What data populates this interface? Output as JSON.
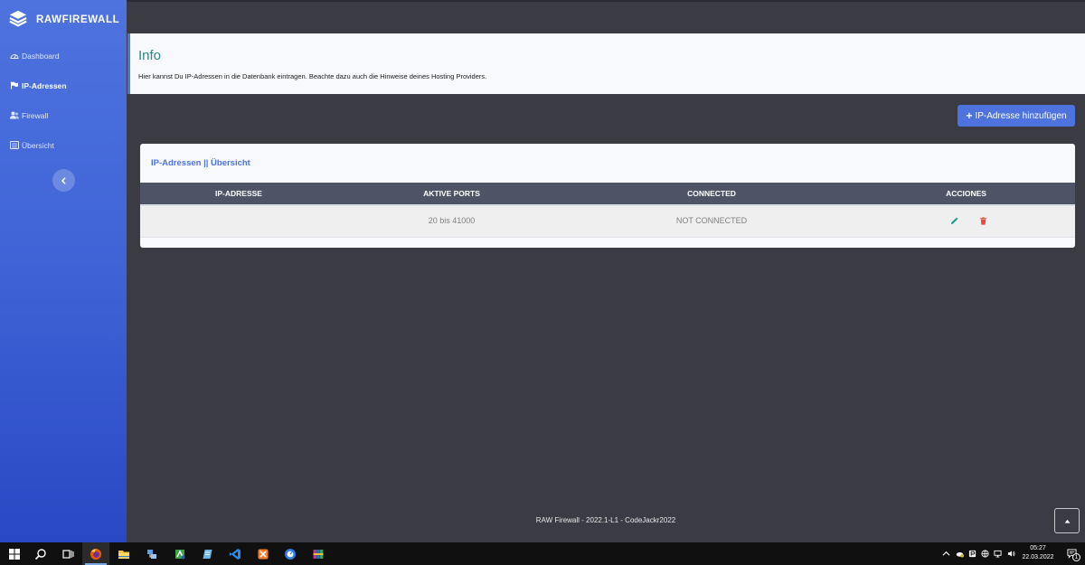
{
  "sidebar": {
    "brand": "RAWFIREWALL",
    "items": [
      {
        "label": "Dashboard",
        "icon": "dashboard-icon",
        "active": false
      },
      {
        "label": "IP-Adressen",
        "icon": "flag-icon",
        "active": true
      },
      {
        "label": "Firewall",
        "icon": "users-icon",
        "active": false
      },
      {
        "label": "Übersicht",
        "icon": "list-icon",
        "active": false
      }
    ],
    "collapse_icon": "chevron-left-icon"
  },
  "info": {
    "title": "Info",
    "text": "Hier kannst Du IP-Adressen in die Datenbank eintragen. Beachte dazu auch die Hinweise deines Hosting Providers."
  },
  "add_button": {
    "icon": "plus-icon",
    "label": "IP-Adresse hinzufügen"
  },
  "card": {
    "title": "IP-Adressen || Übersicht",
    "columns": [
      "IP-ADRESSE",
      "AKTIVE PORTS",
      "CONNECTED",
      "ACCIONES"
    ],
    "rows": [
      {
        "ip": "",
        "ports": "20 bis 41000",
        "connected": "NOT CONNECTED"
      }
    ]
  },
  "footer": {
    "text": "RAW Firewall - 2022.1-L1 - CodeJackr2022"
  },
  "colors": {
    "accent": "#4e73df",
    "info_title": "#2a8a83",
    "edit": "#1a9e86",
    "delete": "#e74a3b",
    "background": "#3a3b43"
  },
  "taskbar": {
    "apps": [
      "windows-start-icon",
      "search-icon",
      "task-view-icon",
      "firefox-icon",
      "file-explorer-icon",
      "network-tool-icon",
      "app-icon",
      "notepad-icon",
      "vscode-icon",
      "xampp-icon",
      "browser-icon",
      "archive-icon"
    ],
    "time": "05:27",
    "date": "22.03.2022",
    "notification_count": "1"
  }
}
